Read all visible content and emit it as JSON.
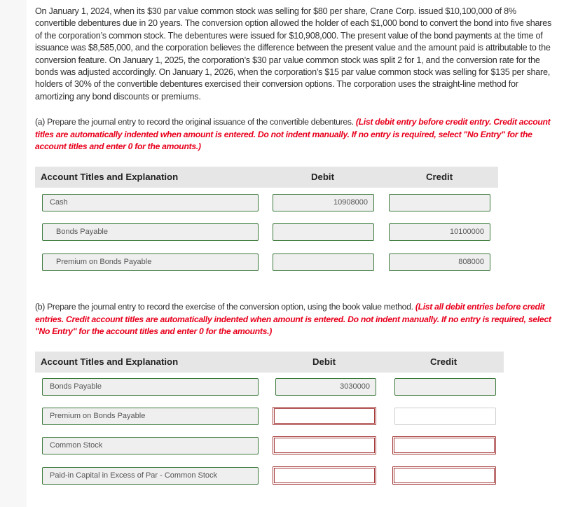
{
  "problem_text": "On January 1, 2024, when its $30 par value common stock was selling for $80 per share, Crane Corp. issued $10,100,000 of 8% convertible debentures due in 20 years. The conversion option allowed the holder of each $1,000 bond to convert the bond into five shares of the corporation’s common stock. The debentures were issued for $10,908,000. The present value of the bond payments at the time of issuance was $8,585,000, and the corporation believes the difference between the present value and the amount paid is attributable to the conversion feature. On January 1, 2025, the corporation’s $30 par value common stock was split 2 for 1, and the conversion rate for the bonds was adjusted accordingly. On January 1, 2026, when the corporation’s $15 par value common stock was selling for $135 per share, holders of 30% of the convertible debentures exercised their conversion options. The corporation uses the straight-line method for amortizing any bond discounts or premiums.",
  "part_a": {
    "label": "(a) Prepare the ",
    "journal_word": "journal",
    "text": " entry to record the original issuance of the convertible debentures. ",
    "instruction": "(List debit entry before credit entry. Credit account titles are automatically indented when amount is entered. Do not indent manually. If no entry is required, select \"No Entry\" for the account titles and enter 0 for the amounts.)",
    "headers": {
      "account": "Account Titles and Explanation",
      "debit": "Debit",
      "credit": "Credit"
    },
    "rows": [
      {
        "account": "Cash",
        "debit": "10908000",
        "credit": ""
      },
      {
        "account": "Bonds Payable",
        "debit": "",
        "credit": "10100000"
      },
      {
        "account": "Premium on Bonds Payable",
        "debit": "",
        "credit": "808000"
      }
    ]
  },
  "part_b": {
    "label": "(b) Prepare the ",
    "journal_word": "journal",
    "text": " entry to record the exercise of the conversion option, using the book value method. ",
    "instruction": "(List all debit entries before credit entries. Credit account titles are automatically indented when amount is entered. Do not indent manually. If no entry is required, select \"No Entry\" for the account titles and enter 0 for the amounts.)",
    "headers": {
      "account": "Account Titles and Explanation",
      "debit": "Debit",
      "credit": "Credit"
    },
    "rows": [
      {
        "account": "Bonds Payable",
        "debit": "3030000",
        "credit": ""
      },
      {
        "account": "Premium on Bonds Payable",
        "debit": "",
        "credit": ""
      },
      {
        "account": "Common Stock",
        "debit": "",
        "credit": ""
      },
      {
        "account": "Paid-in Capital in Excess of Par - Common Stock",
        "debit": "",
        "credit": ""
      }
    ]
  },
  "colors": {
    "instruction_red": "#e8001c",
    "correct_border": "#3c7a3c",
    "error_border": "#a53a3a",
    "header_bg": "#e6e6e6"
  }
}
